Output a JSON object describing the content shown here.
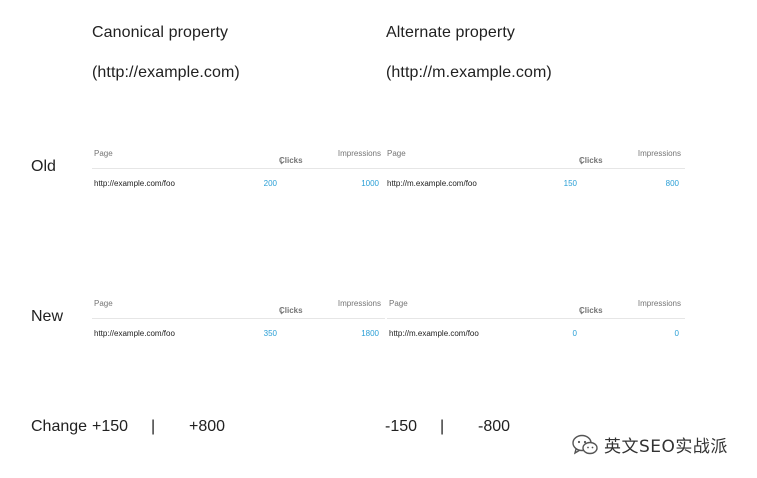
{
  "headers": {
    "canonical": {
      "title": "Canonical property",
      "url": "(http://example.com)"
    },
    "alternate": {
      "title": "Alternate property",
      "url": "(http://m.example.com)"
    }
  },
  "row_labels": {
    "old": "Old",
    "new": "New"
  },
  "table_columns": {
    "page": "Page",
    "clicks": "Clicks",
    "impressions": "Impressions",
    "sort_arrow": "↓"
  },
  "tables": {
    "old_canonical": {
      "page": "http://example.com/foo",
      "clicks": "200",
      "impressions": "1000"
    },
    "old_alternate": {
      "page": "http://m.example.com/foo",
      "clicks": "150",
      "impressions": "800"
    },
    "new_canonical": {
      "page": "http://example.com/foo",
      "clicks": "350",
      "impressions": "1800"
    },
    "new_alternate": {
      "page": "http://m.example.com/foo",
      "clicks": "0",
      "impressions": "0"
    }
  },
  "change": {
    "label": "Change",
    "canonical_clicks": "+150",
    "canonical_impressions": "+800",
    "alternate_clicks": "-150",
    "alternate_impressions": "-800",
    "separator": "|"
  },
  "watermark": {
    "text": "英文SEO实战派",
    "icon": "wechat-icon"
  },
  "colors": {
    "accent": "#2a9fd6",
    "text": "#212121",
    "muted": "#757575"
  }
}
